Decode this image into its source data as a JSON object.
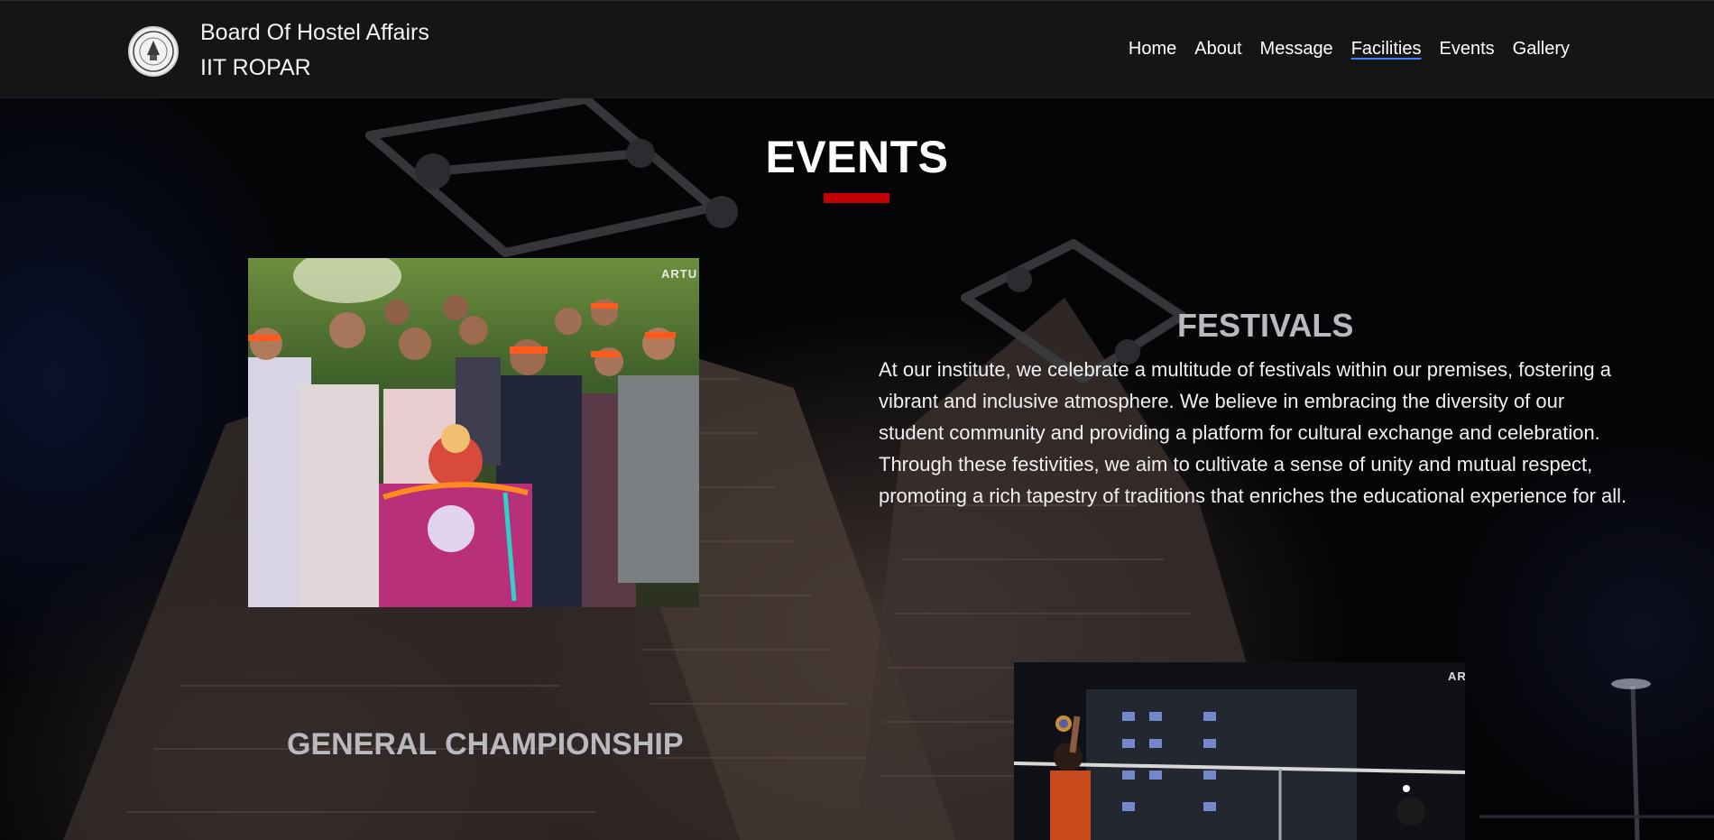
{
  "header": {
    "brand_title": "Board Of Hostel Affairs",
    "brand_subtitle": "IIT ROPAR",
    "logo_icon": "hostel-board-logo-icon"
  },
  "nav": {
    "items": [
      {
        "label": "Home",
        "active": false
      },
      {
        "label": "About",
        "active": false
      },
      {
        "label": "Message",
        "active": false
      },
      {
        "label": "Facilities",
        "active": true
      },
      {
        "label": "Events",
        "active": false
      },
      {
        "label": "Gallery",
        "active": false
      }
    ]
  },
  "section": {
    "title": "EVENTS",
    "accent_color": "#c20000"
  },
  "festivals": {
    "heading": "FESTIVALS",
    "body": "At our institute, we celebrate a multitude of festivals within our premises, fostering a vibrant and inclusive atmosphere. We believe in embracing the diversity of our student community and providing a platform for cultural exchange and celebration. Through these festivities, we aim to cultivate a sense of unity and mutual respect, promoting a rich tapestry of traditions that enriches the educational experience for all.",
    "photo_watermark": "ARTU"
  },
  "general_championship": {
    "heading": "GENERAL CHAMPIONSHIP",
    "photo_watermark": "ART"
  }
}
